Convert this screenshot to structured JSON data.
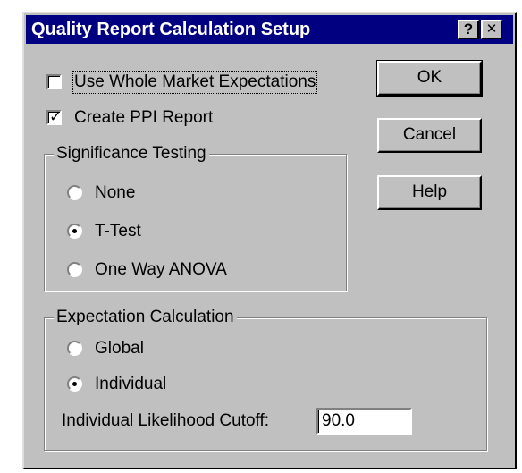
{
  "window": {
    "title": "Quality Report Calculation Setup",
    "help_glyph": "?",
    "close_glyph": "✕"
  },
  "options": {
    "whole_market": {
      "label": "Use Whole Market Expectations",
      "checked": false
    },
    "create_ppi": {
      "label": "Create PPI Report",
      "checked": true
    }
  },
  "significance": {
    "title": "Significance Testing",
    "options": [
      {
        "label": "None",
        "selected": false
      },
      {
        "label": "T-Test",
        "selected": true
      },
      {
        "label": "One Way ANOVA",
        "selected": false
      }
    ]
  },
  "expectation": {
    "title": "Expectation Calculation",
    "options": [
      {
        "label": "Global",
        "selected": false
      },
      {
        "label": "Individual",
        "selected": true
      }
    ],
    "cutoff_label": "Individual Likelihood Cutoff:",
    "cutoff_value": "90.0"
  },
  "buttons": {
    "ok": "OK",
    "cancel": "Cancel",
    "help": "Help"
  },
  "colors": {
    "face": "#c0c0c0",
    "titlebar": "#000080"
  }
}
